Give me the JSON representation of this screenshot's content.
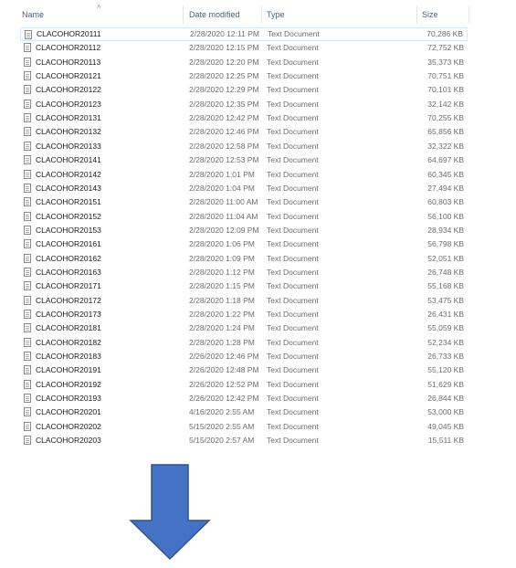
{
  "columns": {
    "name": "Name",
    "date_modified": "Date modified",
    "type": "Type",
    "size": "Size"
  },
  "sort": {
    "column": "name",
    "direction": "ascending"
  },
  "files": [
    {
      "name": "CLACOHOR20111",
      "date": "2/28/2020 12:11 PM",
      "type": "Text Document",
      "size": "70,286 KB",
      "selected": true
    },
    {
      "name": "CLACOHOR20112",
      "date": "2/28/2020 12:15 PM",
      "type": "Text Document",
      "size": "72,752 KB"
    },
    {
      "name": "CLACOHOR20113",
      "date": "2/28/2020 12:20 PM",
      "type": "Text Document",
      "size": "35,373 KB"
    },
    {
      "name": "CLACOHOR20121",
      "date": "2/28/2020 12:25 PM",
      "type": "Text Document",
      "size": "70,751 KB"
    },
    {
      "name": "CLACOHOR20122",
      "date": "2/28/2020 12:29 PM",
      "type": "Text Document",
      "size": "70,101 KB"
    },
    {
      "name": "CLACOHOR20123",
      "date": "2/28/2020 12:35 PM",
      "type": "Text Document",
      "size": "32,142 KB"
    },
    {
      "name": "CLACOHOR20131",
      "date": "2/28/2020 12:42 PM",
      "type": "Text Document",
      "size": "70,255 KB"
    },
    {
      "name": "CLACOHOR20132",
      "date": "2/28/2020 12:46 PM",
      "type": "Text Document",
      "size": "65,856 KB"
    },
    {
      "name": "CLACOHOR20133",
      "date": "2/28/2020 12:58 PM",
      "type": "Text Document",
      "size": "32,322 KB"
    },
    {
      "name": "CLACOHOR20141",
      "date": "2/28/2020 12:53 PM",
      "type": "Text Document",
      "size": "64,697 KB"
    },
    {
      "name": "CLACOHOR20142",
      "date": "2/28/2020 1:01 PM",
      "type": "Text Document",
      "size": "60,345 KB"
    },
    {
      "name": "CLACOHOR20143",
      "date": "2/28/2020 1:04 PM",
      "type": "Text Document",
      "size": "27,494 KB"
    },
    {
      "name": "CLACOHOR20151",
      "date": "2/28/2020 11:00 AM",
      "type": "Text Document",
      "size": "60,803 KB"
    },
    {
      "name": "CLACOHOR20152",
      "date": "2/28/2020 11:04 AM",
      "type": "Text Document",
      "size": "56,100 KB"
    },
    {
      "name": "CLACOHOR20153",
      "date": "2/28/2020 12:09 PM",
      "type": "Text Document",
      "size": "28,934 KB"
    },
    {
      "name": "CLACOHOR20161",
      "date": "2/28/2020 1:06 PM",
      "type": "Text Document",
      "size": "56,798 KB"
    },
    {
      "name": "CLACOHOR20162",
      "date": "2/28/2020 1:09 PM",
      "type": "Text Document",
      "size": "52,051 KB"
    },
    {
      "name": "CLACOHOR20163",
      "date": "2/28/2020 1:12 PM",
      "type": "Text Document",
      "size": "26,748 KB"
    },
    {
      "name": "CLACOHOR20171",
      "date": "2/28/2020 1:15 PM",
      "type": "Text Document",
      "size": "55,168 KB"
    },
    {
      "name": "CLACOHOR20172",
      "date": "2/28/2020 1:18 PM",
      "type": "Text Document",
      "size": "53,475 KB"
    },
    {
      "name": "CLACOHOR20173",
      "date": "2/28/2020 1:22 PM",
      "type": "Text Document",
      "size": "26,431 KB"
    },
    {
      "name": "CLACOHOR20181",
      "date": "2/28/2020 1:24 PM",
      "type": "Text Document",
      "size": "55,059 KB"
    },
    {
      "name": "CLACOHOR20182",
      "date": "2/28/2020 1:28 PM",
      "type": "Text Document",
      "size": "52,234 KB"
    },
    {
      "name": "CLACOHOR20183",
      "date": "2/26/2020 12:46 PM",
      "type": "Text Document",
      "size": "26,733 KB"
    },
    {
      "name": "CLACOHOR20191",
      "date": "2/26/2020 12:48 PM",
      "type": "Text Document",
      "size": "55,120 KB"
    },
    {
      "name": "CLACOHOR20192",
      "date": "2/26/2020 12:52 PM",
      "type": "Text Document",
      "size": "51,629 KB"
    },
    {
      "name": "CLACOHOR20193",
      "date": "2/26/2020 12:42 PM",
      "type": "Text Document",
      "size": "26,844 KB"
    },
    {
      "name": "CLACOHOR20201",
      "date": "4/16/2020 2:55 AM",
      "type": "Text Document",
      "size": "53,000 KB"
    },
    {
      "name": "CLACOHOR20202",
      "date": "5/15/2020 2:55 AM",
      "type": "Text Document",
      "size": "49,045 KB"
    },
    {
      "name": "CLACOHOR20203",
      "date": "5/15/2020 2:57 AM",
      "type": "Text Document",
      "size": "15,511 KB"
    }
  ],
  "icons": {
    "file": "text-document-icon",
    "sort": "sort-ascending-icon",
    "arrow": "down-arrow-icon"
  },
  "colors": {
    "header_text": "#4c607a",
    "selection_border": "#cde8ff",
    "arrow_fill": "#4472c4",
    "arrow_stroke": "#2f528f"
  }
}
